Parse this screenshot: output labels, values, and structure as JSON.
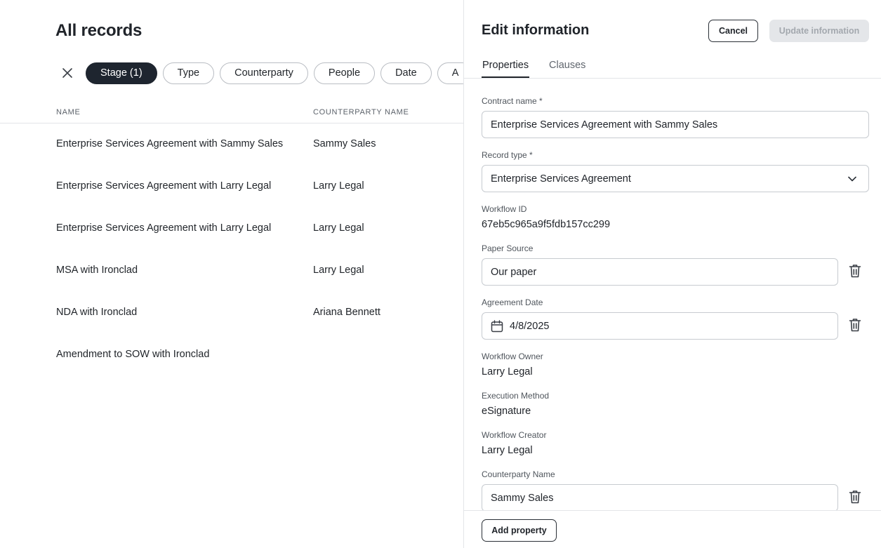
{
  "records": {
    "title": "All records",
    "filters": [
      {
        "label": "Stage (1)",
        "active": true
      },
      {
        "label": "Type",
        "active": false
      },
      {
        "label": "Counterparty",
        "active": false
      },
      {
        "label": "People",
        "active": false
      },
      {
        "label": "Date",
        "active": false
      },
      {
        "label": "A",
        "active": false
      }
    ],
    "columns": {
      "name": "NAME",
      "counterparty": "COUNTERPARTY NAME"
    },
    "rows": [
      {
        "name": "Enterprise Services Agreement with Sammy Sales",
        "counterparty": "Sammy Sales"
      },
      {
        "name": "Enterprise Services Agreement with Larry Legal",
        "counterparty": "Larry Legal"
      },
      {
        "name": "Enterprise Services Agreement with Larry Legal",
        "counterparty": "Larry Legal"
      },
      {
        "name": "MSA with Ironclad",
        "counterparty": "Larry Legal"
      },
      {
        "name": "NDA with Ironclad",
        "counterparty": "Ariana Bennett"
      },
      {
        "name": "Amendment to SOW with Ironclad",
        "counterparty": ""
      }
    ]
  },
  "panel": {
    "title": "Edit information",
    "cancel_label": "Cancel",
    "update_label": "Update information",
    "tabs": [
      {
        "label": "Properties",
        "active": true
      },
      {
        "label": "Clauses",
        "active": false
      }
    ],
    "fields": {
      "contract_name": {
        "label": "Contract name *",
        "value": "Enterprise Services Agreement with Sammy Sales"
      },
      "record_type": {
        "label": "Record type *",
        "value": "Enterprise Services Agreement"
      },
      "workflow_id": {
        "label": "Workflow ID",
        "value": "67eb5c965a9f5fdb157cc299"
      },
      "paper_source": {
        "label": "Paper Source",
        "value": "Our paper"
      },
      "agreement_date": {
        "label": "Agreement Date",
        "value": "4/8/2025"
      },
      "workflow_owner": {
        "label": "Workflow Owner",
        "value": "Larry Legal"
      },
      "execution_method": {
        "label": "Execution Method",
        "value": "eSignature"
      },
      "workflow_creator": {
        "label": "Workflow Creator",
        "value": "Larry Legal"
      },
      "counterparty_name": {
        "label": "Counterparty Name",
        "value": "Sammy Sales"
      }
    },
    "add_property_label": "Add property"
  },
  "icons": {
    "clear": "close-icon",
    "chevron": "chevron-down-icon",
    "calendar": "calendar-icon",
    "trash": "trash-icon"
  },
  "colors": {
    "active_chip": "#1e252f",
    "border": "#e3e5e8",
    "disabled_button": "#e4e6e9"
  }
}
